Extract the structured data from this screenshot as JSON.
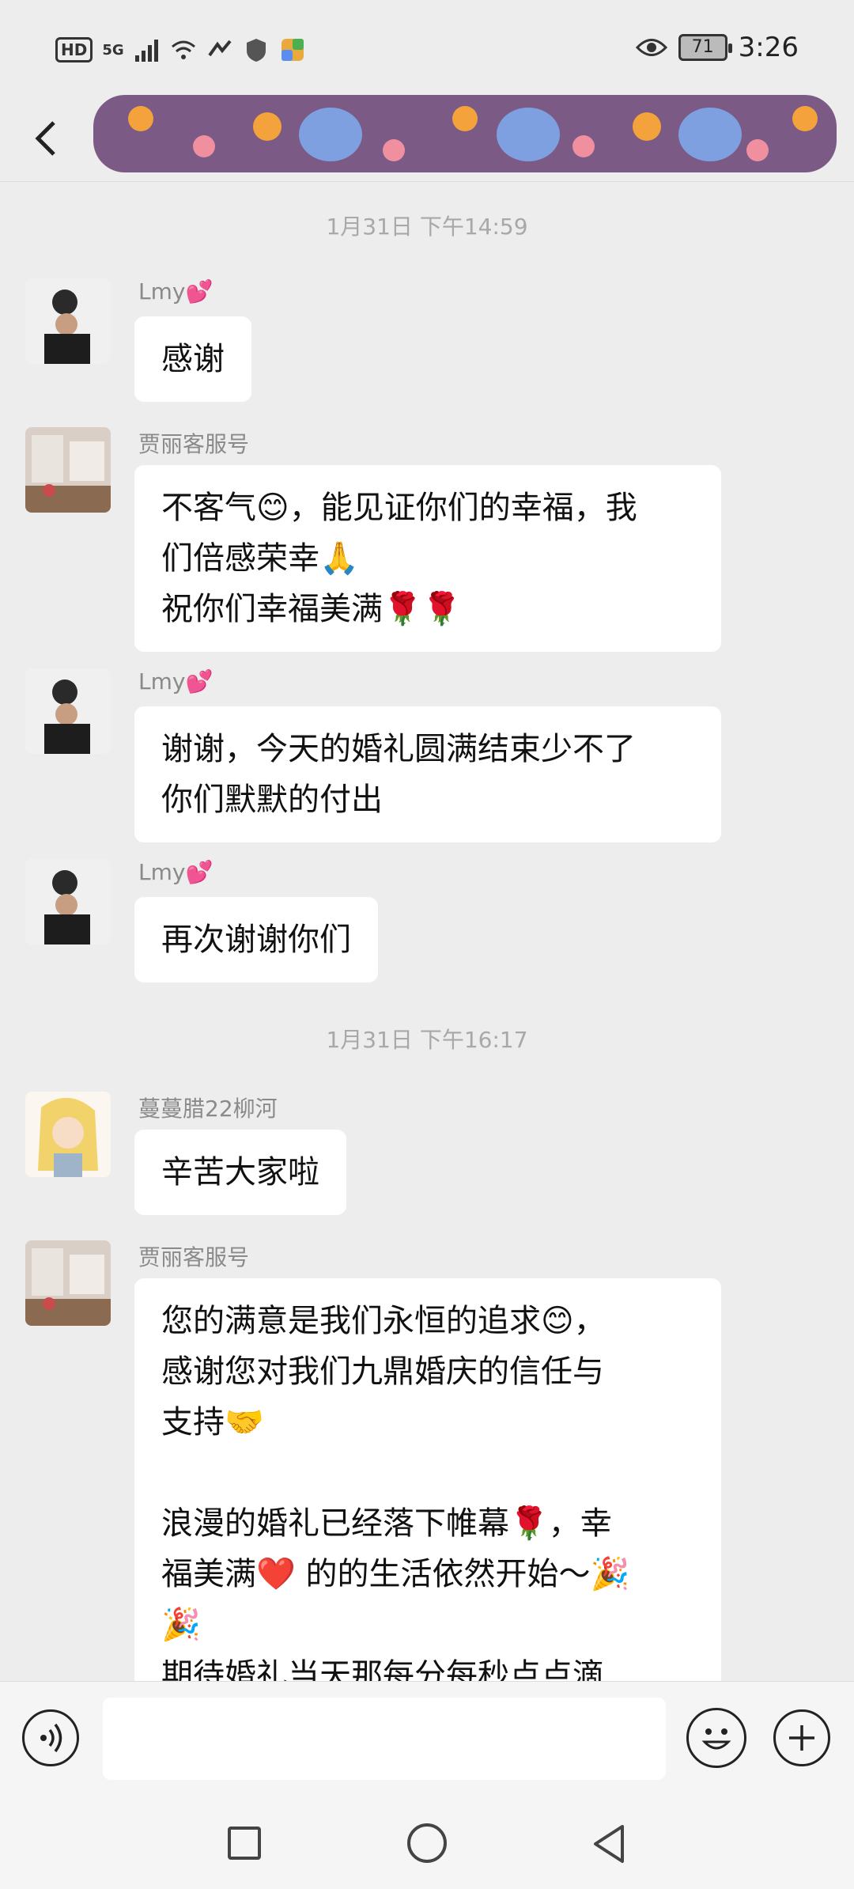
{
  "status_bar": {
    "hd": "HD",
    "network": "5G",
    "battery": "71",
    "time": "3:26"
  },
  "header": {
    "back_icon": "chevron-left-icon",
    "title": ""
  },
  "messages": [
    {
      "type": "time",
      "text": "1月31日 下午14:59"
    },
    {
      "type": "msg",
      "sender": "Lmy💕",
      "text": "感谢"
    },
    {
      "type": "msg",
      "sender": "贾丽客服号",
      "text": "不客气😊，能见证你们的幸福，我\n们倍感荣幸🙏\n祝你们幸福美满🌹🌹"
    },
    {
      "type": "msg",
      "sender": "Lmy💕",
      "text": "谢谢，今天的婚礼圆满结束少不了\n你们默默的付出"
    },
    {
      "type": "msg",
      "sender": "Lmy💕",
      "text": "再次谢谢你们"
    },
    {
      "type": "time",
      "text": "1月31日 下午16:17"
    },
    {
      "type": "msg",
      "sender": "蔓蔓腊22柳河",
      "text": "辛苦大家啦"
    },
    {
      "type": "msg",
      "sender": "贾丽客服号",
      "text": "您的满意是我们永恒的追求😊，\n感谢您对我们九鼎婚庆的信任与\n支持🤝\n\n浪漫的婚礼已经落下帷幕🌹，幸\n福美满❤️ 的的生活依然开始～🎉\n🎉\n期待婚礼当天那每分每秒点点滴"
    }
  ],
  "input_bar": {
    "voice_icon": "voice-icon",
    "emoji_icon": "emoji-icon",
    "plus_icon": "plus-icon",
    "placeholder": ""
  }
}
